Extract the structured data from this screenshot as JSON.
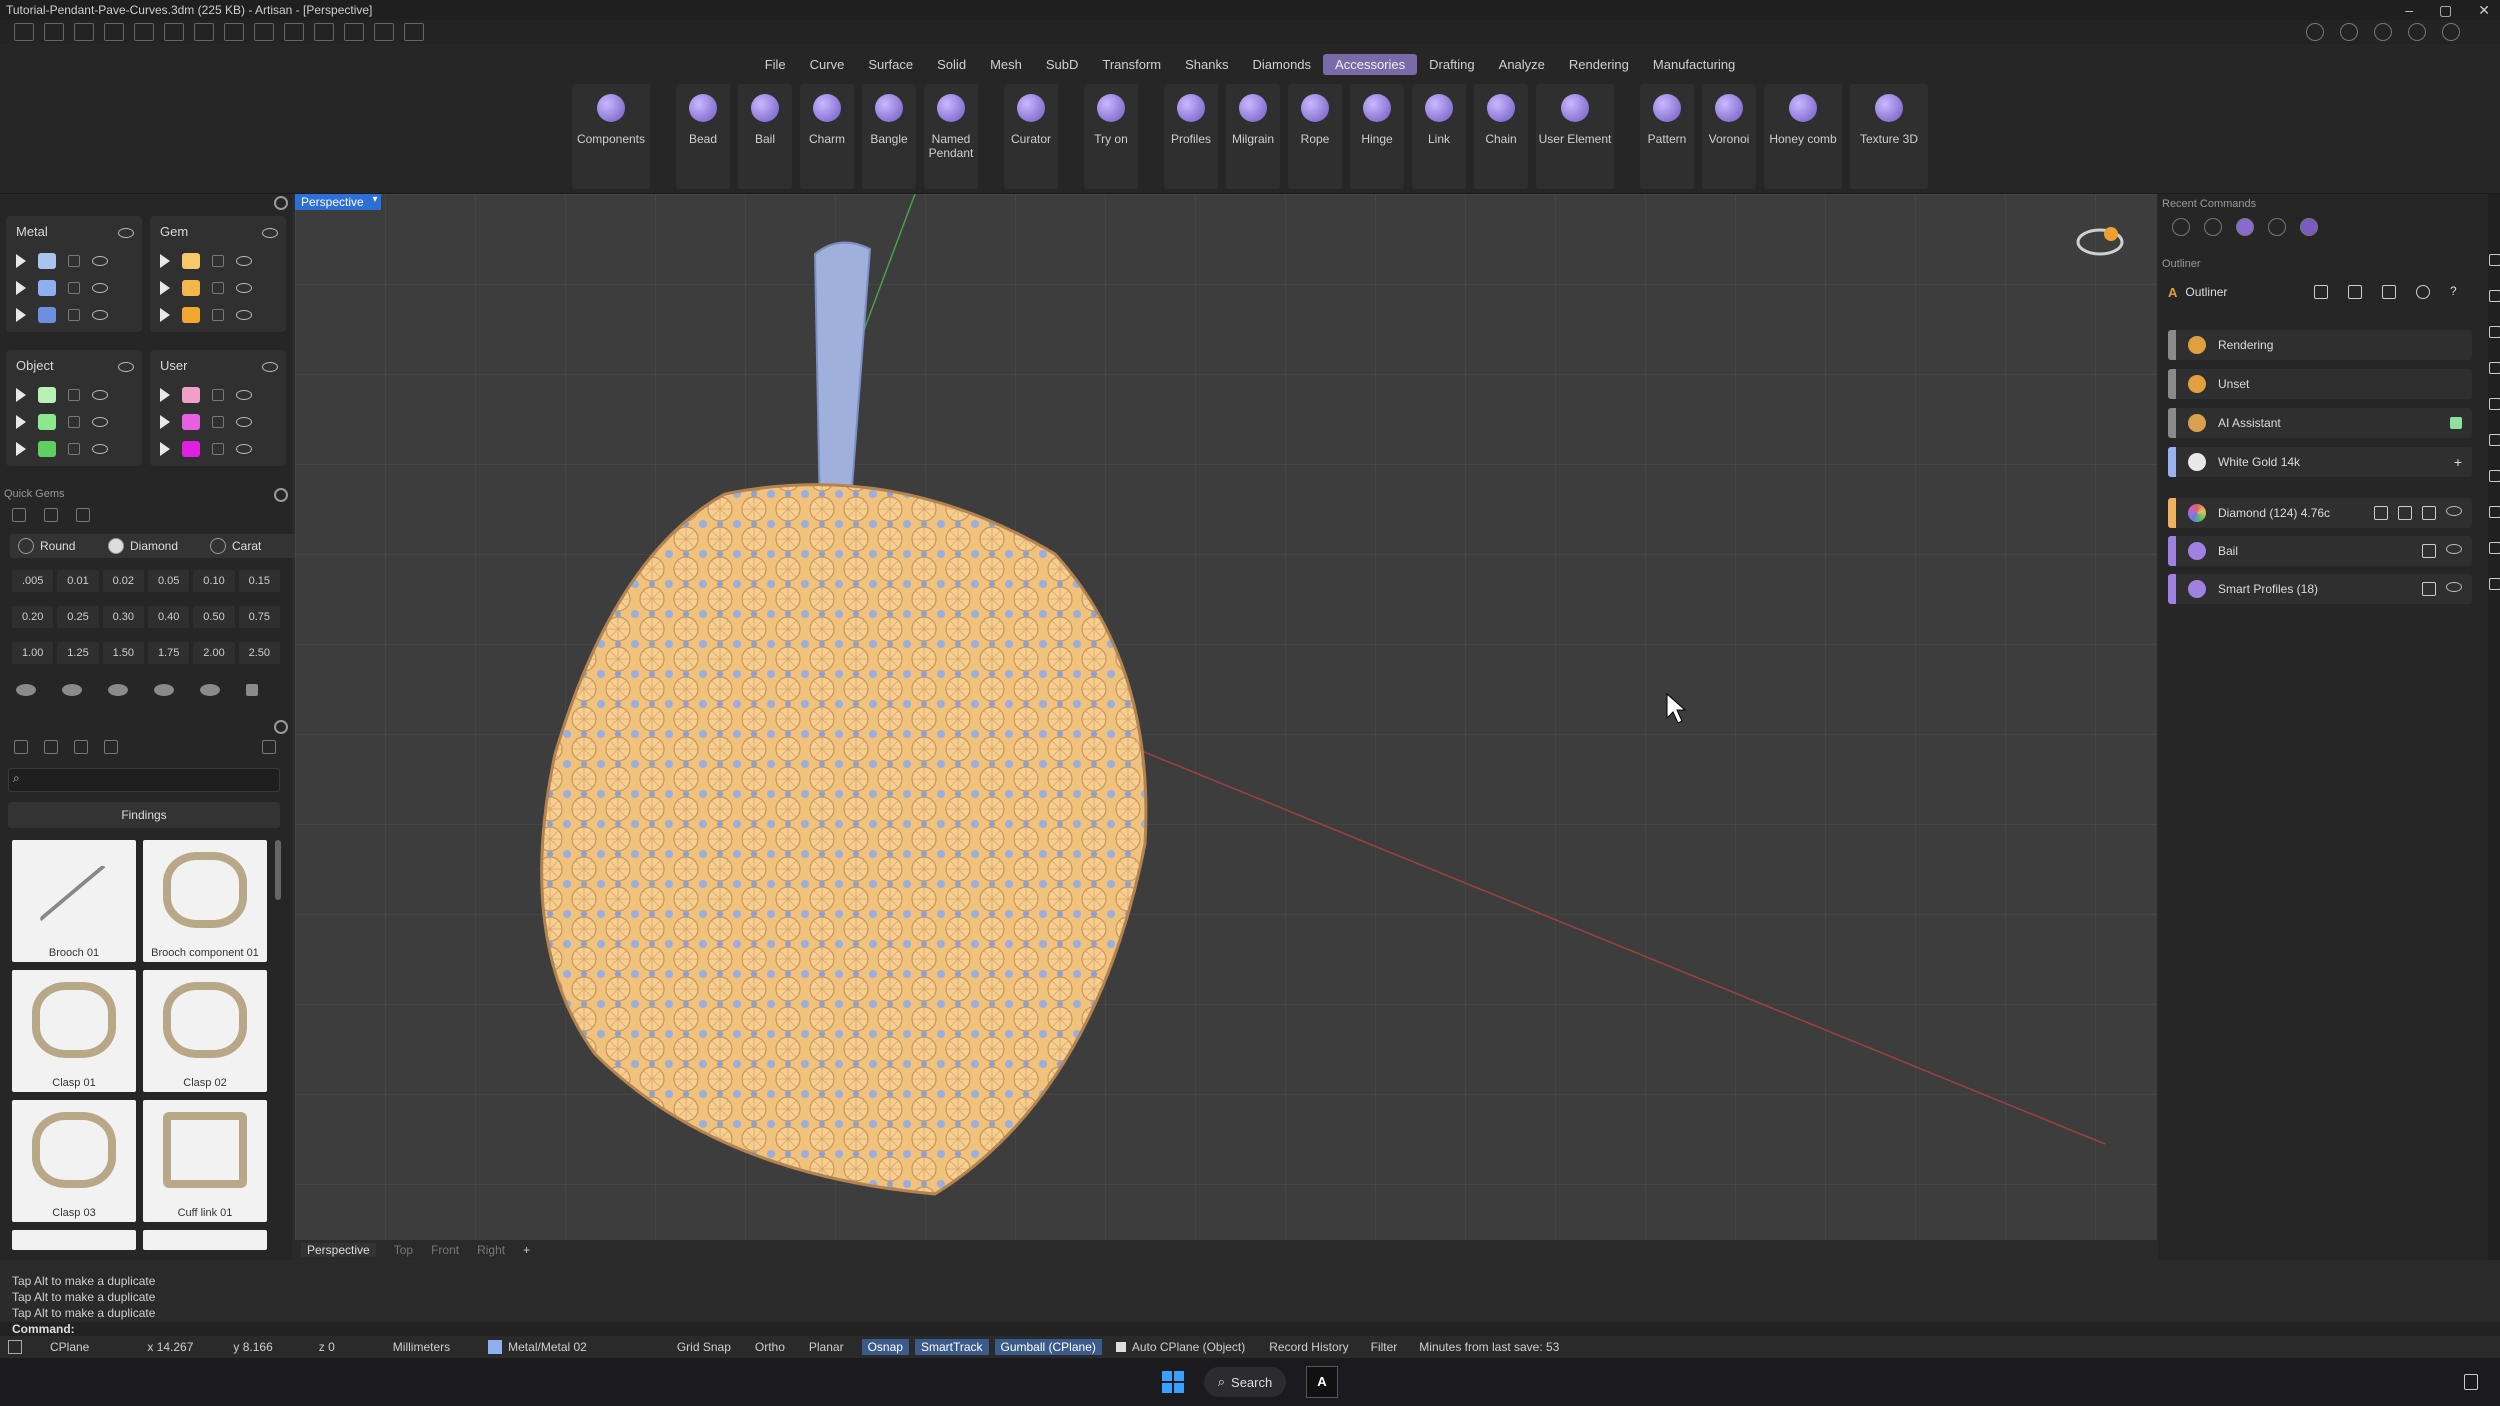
{
  "window": {
    "title": "Tutorial-Pendant-Pave-Curves.3dm (225 KB) - Artisan - [Perspective]",
    "controls": [
      "–",
      "▢",
      "✕"
    ]
  },
  "menu": {
    "tabs": [
      "File",
      "Curve",
      "Surface",
      "Solid",
      "Mesh",
      "SubD",
      "Transform",
      "Shanks",
      "Diamonds",
      "Accessories",
      "Drafting",
      "Analyze",
      "Rendering",
      "Manufacturing"
    ],
    "active": "Accessories"
  },
  "ribbon": {
    "tools": [
      "Components",
      "Bead",
      "Bail",
      "Charm",
      "Bangle",
      "Named\nPendant",
      "Curator",
      "Try on",
      "Profiles",
      "Milgrain",
      "Rope",
      "Hinge",
      "Link",
      "Chain",
      "User Element",
      "Pattern",
      "Voronoi",
      "Honey comb",
      "Texture 3D"
    ]
  },
  "layers": {
    "metal": {
      "label": "Metal",
      "colors": [
        "#aac4f0",
        "#8fb0f0",
        "#6e8fe0"
      ]
    },
    "gem": {
      "label": "Gem",
      "colors": [
        "#f6c96a",
        "#f4b84a",
        "#f2a830"
      ]
    },
    "object": {
      "label": "Object",
      "colors": [
        "#b8f0b8",
        "#8de88d",
        "#5fcf5f"
      ]
    },
    "user": {
      "label": "User",
      "colors": [
        "#f0a0c8",
        "#e860e0",
        "#e020e0"
      ]
    }
  },
  "quick_gems": {
    "header": "Quick Gems",
    "shape": "Round",
    "material": "Diamond",
    "unit": "Carat",
    "sizes": [
      ".005",
      "0.01",
      "0.02",
      "0.05",
      "0.10",
      "0.15",
      "0.20",
      "0.25",
      "0.30",
      "0.40",
      "0.50",
      "0.75",
      "1.00",
      "1.25",
      "1.50",
      "1.75",
      "2.00",
      "2.50"
    ]
  },
  "library": {
    "category": "Findings",
    "items": [
      "Brooch 01",
      "Brooch component 01",
      "Clasp 01",
      "Clasp 02",
      "Clasp 03",
      "Cuff link 01"
    ]
  },
  "viewport": {
    "label": "Perspective",
    "tabs": [
      "Perspective",
      "Top",
      "Front",
      "Right",
      "+"
    ]
  },
  "right_panel": {
    "recent_header": "Recent Commands",
    "outliner_header": "Outliner",
    "outliner_title": "Outliner",
    "rows": [
      {
        "label": "Rendering",
        "bar": "#8a8a8a",
        "icon": "#e0a040"
      },
      {
        "label": "Unset",
        "bar": "#8a8a8a",
        "icon": "#e0a040"
      },
      {
        "label": "AI Assistant",
        "bar": "#8a8a8a",
        "icon": "#d8a050"
      },
      {
        "label": "White Gold 14k",
        "bar": "#9ab0f0",
        "icon": "#e8e8e8"
      },
      {
        "label": "Diamond (124) 4.76c",
        "bar": "#f0b060",
        "icon": "#c0a0f0"
      },
      {
        "label": "Bail",
        "bar": "#a080e0",
        "icon": "#a080e0"
      },
      {
        "label": "Smart Profiles (18)",
        "bar": "#a080e0",
        "icon": "#a080e0"
      }
    ]
  },
  "command": {
    "history": [
      "Tap Alt to make a duplicate",
      "Tap Alt to make a duplicate",
      "Tap Alt to make a duplicate"
    ],
    "prompt": "Command:"
  },
  "status": {
    "cplane": "CPlane",
    "x": "x 14.267",
    "y": "y 8.166",
    "z": "z 0",
    "units": "Millimeters",
    "layer": "Metal/Metal 02",
    "grid_snap": "Grid Snap",
    "ortho": "Ortho",
    "planar": "Planar",
    "osnap": "Osnap",
    "smarttrack": "SmartTrack",
    "gumball": "Gumball (CPlane)",
    "auto_cplane": "Auto CPlane (Object)",
    "record_history": "Record History",
    "filter": "Filter",
    "last_save": "Minutes from last save: 53"
  },
  "taskbar": {
    "search": "Search",
    "app": "A"
  }
}
